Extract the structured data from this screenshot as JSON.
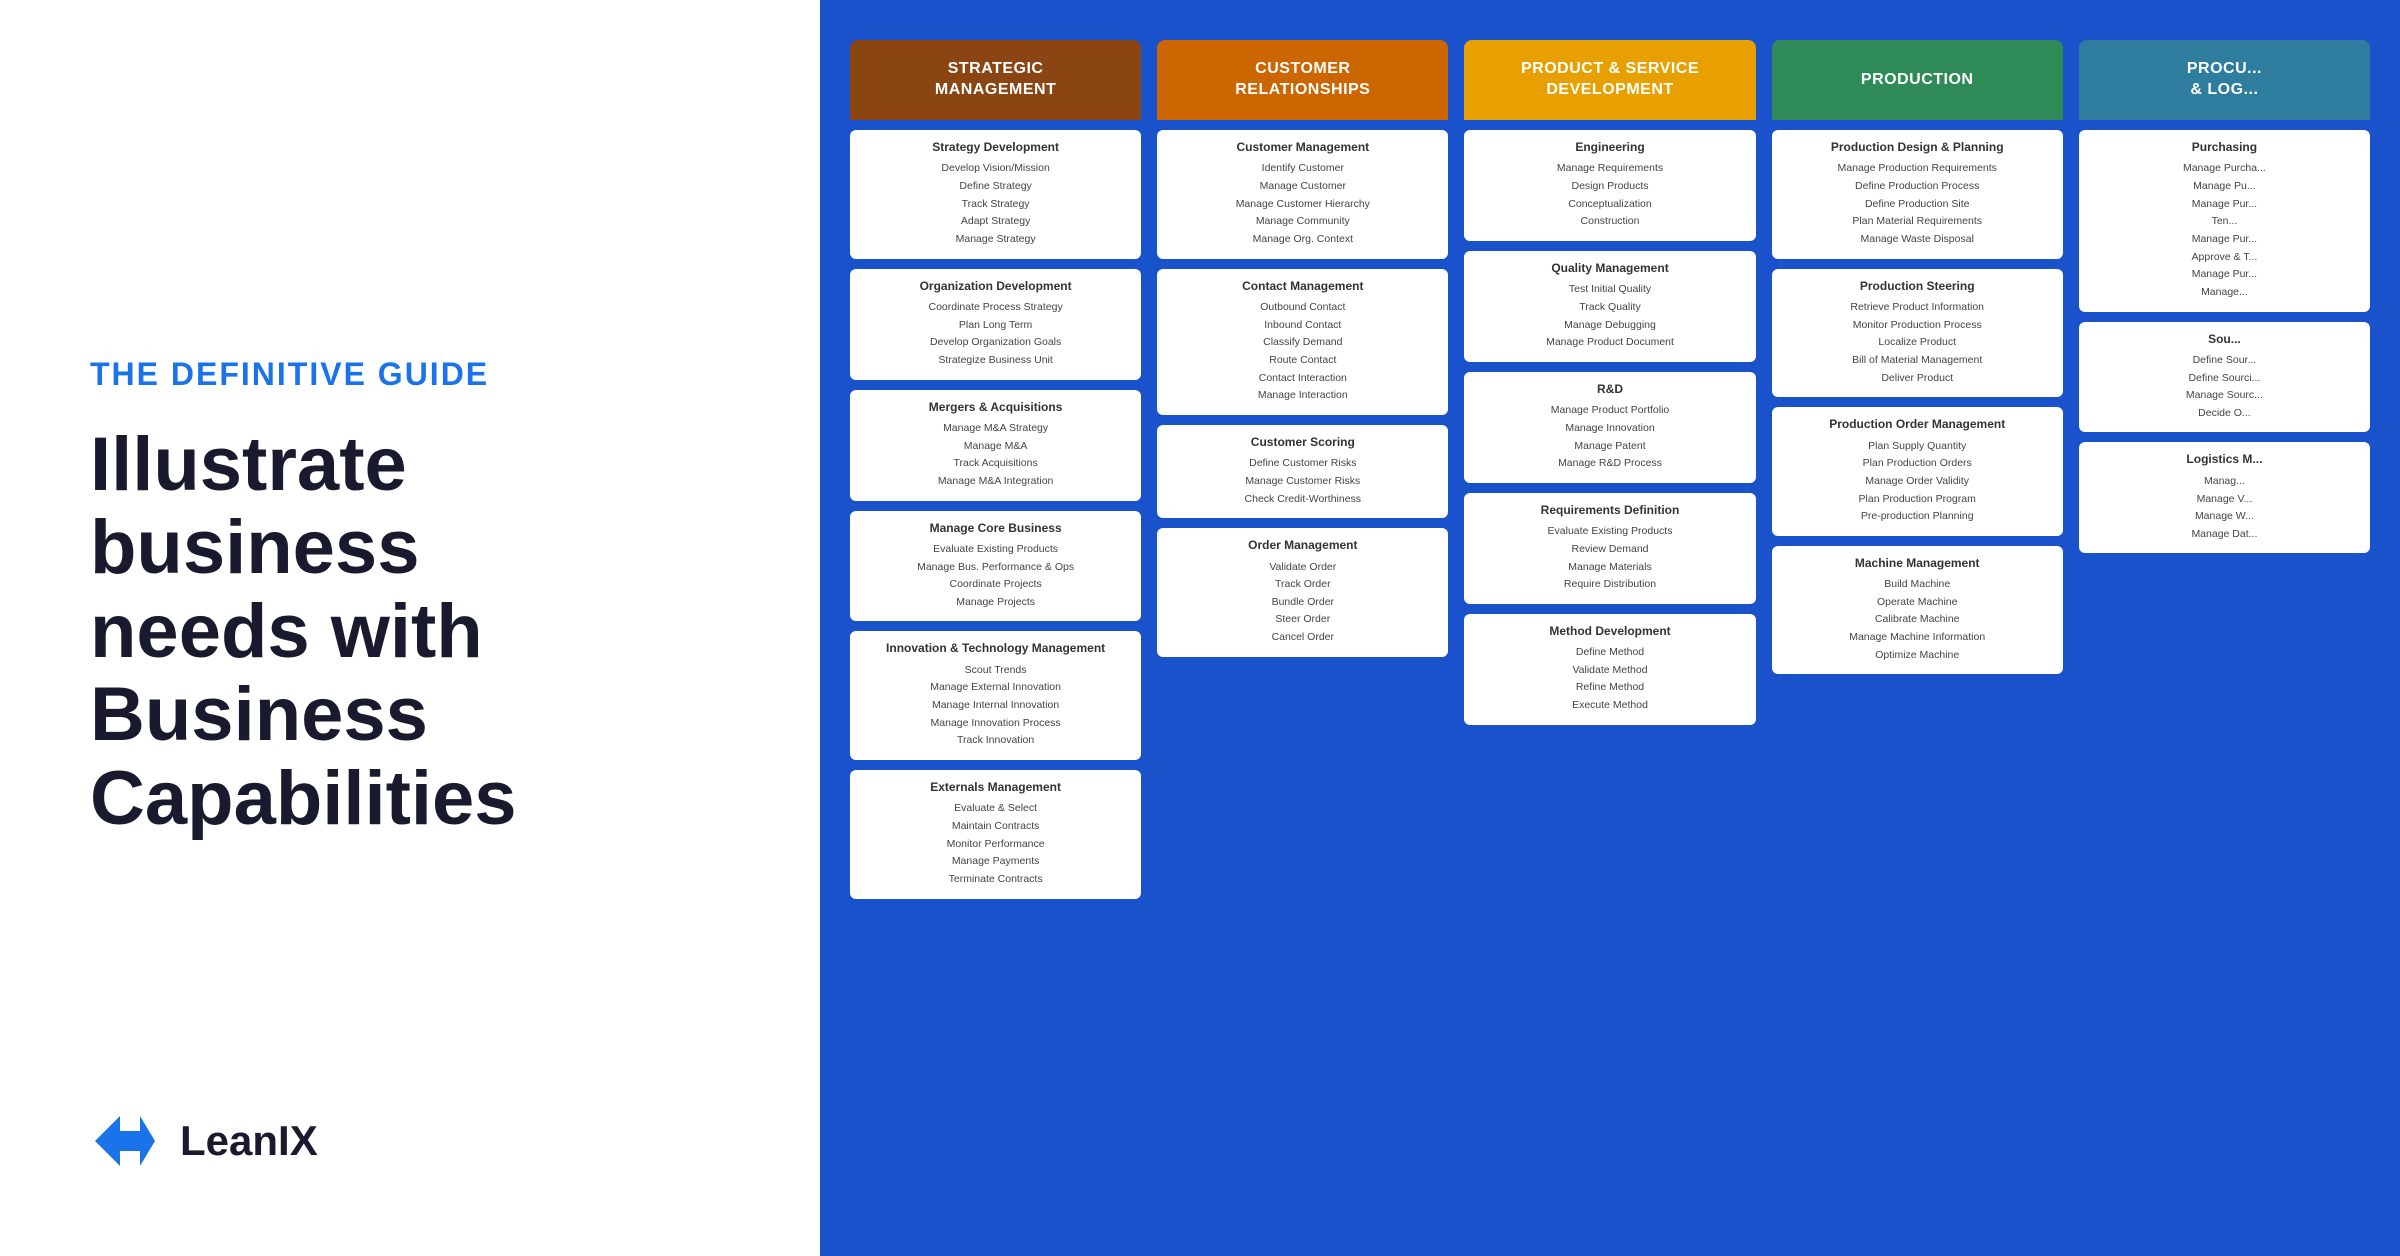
{
  "left": {
    "guide_label": "THE DEFINITIVE GUIDE",
    "heading_line1": "Illustrate business",
    "heading_line2": "needs with Business",
    "heading_line3": "Capabilities",
    "logo_text": "LeanIX"
  },
  "columns": [
    {
      "id": "strategic",
      "header": "STRATEGIC\nMANAGEMENT",
      "color_class": "strategic",
      "groups": [
        {
          "title": "Strategy Development",
          "items": [
            "Develop Vision/Mission",
            "Define Strategy",
            "Track Strategy",
            "Adapt Strategy",
            "Manage Strategy"
          ]
        },
        {
          "title": "Organization Development",
          "items": [
            "Coordinate Process Strategy",
            "Plan Long Term",
            "Develop Organization Goals",
            "Strategize Business Unit"
          ]
        },
        {
          "title": "Mergers & Acquisitions",
          "items": [
            "Manage M&A Strategy",
            "Manage M&A",
            "Track Acquisitions",
            "Manage M&A Integration"
          ]
        },
        {
          "title": "Manage Core Business",
          "items": [
            "Evaluate Existing Products",
            "Manage Bus. Performance & Ops",
            "Coordinate Projects",
            "Manage Projects"
          ]
        },
        {
          "title": "Innovation & Technology Management",
          "items": [
            "Scout Trends",
            "Manage External Innovation",
            "Manage Internal Innovation",
            "Manage Innovation Process",
            "Track Innovation"
          ]
        },
        {
          "title": "Externals Management",
          "items": [
            "Evaluate & Select",
            "Maintain Contracts",
            "Monitor Performance",
            "Manage Payments",
            "Terminate Contracts"
          ]
        }
      ]
    },
    {
      "id": "customer",
      "header": "CUSTOMER\nRELATIONSHIPS",
      "color_class": "customer",
      "groups": [
        {
          "title": "Customer Management",
          "items": [
            "Identify Customer",
            "Manage Customer",
            "Manage Customer Hierarchy",
            "Manage Community",
            "Manage Org. Context"
          ]
        },
        {
          "title": "Contact Management",
          "items": [
            "Outbound Contact",
            "Inbound Contact",
            "Classify Demand",
            "Route Contact",
            "Contact Interaction",
            "Manage Interaction"
          ]
        },
        {
          "title": "Customer Scoring",
          "items": [
            "Define Customer Risks",
            "Manage Customer Risks",
            "Check Credit-Worthiness"
          ]
        },
        {
          "title": "Order Management",
          "items": [
            "Validate Order",
            "Track Order",
            "Bundle Order",
            "Steer Order",
            "Cancel Order"
          ]
        }
      ]
    },
    {
      "id": "product",
      "header": "PRODUCT & SERVICE\nDEVELOPMENT",
      "color_class": "product",
      "groups": [
        {
          "title": "Engineering",
          "items": [
            "Manage Requirements",
            "Design Products",
            "Conceptualization",
            "Construction"
          ]
        },
        {
          "title": "Quality Management",
          "items": [
            "Test Initial Quality",
            "Track Quality",
            "Manage Debugging",
            "Manage Product Document"
          ]
        },
        {
          "title": "R&D",
          "items": [
            "Manage Product Portfolio",
            "Manage Innovation",
            "Manage Patent",
            "Manage R&D Process"
          ]
        },
        {
          "title": "Requirements Definition",
          "items": [
            "Evaluate Existing Products",
            "Review Demand",
            "Manage Materials",
            "Require Distribution"
          ]
        },
        {
          "title": "Method Development",
          "items": [
            "Define Method",
            "Validate Method",
            "Refine Method",
            "Execute Method"
          ]
        }
      ]
    },
    {
      "id": "production",
      "header": "PRODUCTION",
      "color_class": "production",
      "groups": [
        {
          "title": "Production Design & Planning",
          "items": [
            "Manage Production Requirements",
            "Define Production Process",
            "Define Production Site",
            "Plan Material Requirements",
            "Manage Waste Disposal"
          ]
        },
        {
          "title": "Production Steering",
          "items": [
            "Retrieve Product Information",
            "Monitor Production Process",
            "Localize Product",
            "Bill of Material Management",
            "Deliver Product"
          ]
        },
        {
          "title": "Production Order Management",
          "items": [
            "Plan Supply Quantity",
            "Plan Production Orders",
            "Manage Order Validity",
            "Plan Production Program",
            "Pre-production Planning"
          ]
        },
        {
          "title": "Machine Management",
          "items": [
            "Build Machine",
            "Operate Machine",
            "Calibrate Machine",
            "Manage Machine Information",
            "Optimize Machine"
          ]
        }
      ]
    },
    {
      "id": "procurement",
      "header": "PROCU...\n& LOG...",
      "color_class": "procurement",
      "groups": [
        {
          "title": "Purchasing",
          "items": [
            "Manage Purcha...",
            "Manage Pu...",
            "Manage Pur...",
            "Ten...",
            "Manage Pur...",
            "Approve & T...",
            "Manage Pur...",
            "Manage..."
          ]
        },
        {
          "title": "Sou...",
          "items": [
            "Define Sour...",
            "Define Sourci...",
            "Manage Sourc...",
            "Decide O..."
          ]
        },
        {
          "title": "Logistics M...",
          "items": [
            "Manag...",
            "Manage V...",
            "Manage W...",
            "Manage Dat..."
          ]
        }
      ]
    }
  ]
}
